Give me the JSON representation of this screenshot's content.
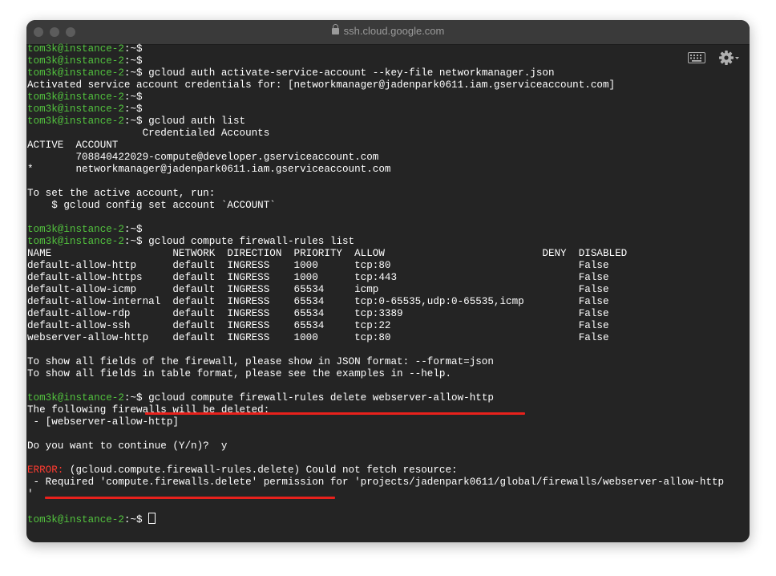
{
  "window": {
    "title": "ssh.cloud.google.com",
    "icons": [
      "keyboard-icon",
      "gear-icon",
      "lock-icon"
    ]
  },
  "colors": {
    "prompt": "#52c23e",
    "error": "#ff3b30",
    "underline": "#e8211c",
    "background": "#242424",
    "text": "#ffffff"
  },
  "terminal": {
    "prompt": "tom3k@instance-2",
    "prompt_suffix": ":~$ ",
    "lines": [
      {
        "prompt": true,
        "text": ""
      },
      {
        "prompt": true,
        "text": ""
      },
      {
        "prompt": true,
        "text": "gcloud auth activate-service-account --key-file networkmanager.json"
      },
      {
        "prompt": false,
        "text": "Activated service account credentials for: [networkmanager@jadenpark0611.iam.gserviceaccount.com]"
      },
      {
        "prompt": true,
        "text": ""
      },
      {
        "prompt": true,
        "text": ""
      },
      {
        "prompt": true,
        "text": "gcloud auth list"
      },
      {
        "prompt": false,
        "text": "                   Credentialed Accounts"
      },
      {
        "prompt": false,
        "text": "ACTIVE  ACCOUNT"
      },
      {
        "prompt": false,
        "text": "        708840422029-compute@developer.gserviceaccount.com"
      },
      {
        "prompt": false,
        "text": "*       networkmanager@jadenpark0611.iam.gserviceaccount.com"
      },
      {
        "prompt": false,
        "text": ""
      },
      {
        "prompt": false,
        "text": "To set the active account, run:"
      },
      {
        "prompt": false,
        "text": "    $ gcloud config set account `ACCOUNT`"
      },
      {
        "prompt": false,
        "text": ""
      },
      {
        "prompt": true,
        "text": ""
      },
      {
        "prompt": true,
        "text": "gcloud compute firewall-rules list"
      },
      {
        "prompt": false,
        "text": "NAME                    NETWORK  DIRECTION  PRIORITY  ALLOW                          DENY  DISABLED"
      },
      {
        "prompt": false,
        "text": "default-allow-http      default  INGRESS    1000      tcp:80                               False"
      },
      {
        "prompt": false,
        "text": "default-allow-https     default  INGRESS    1000      tcp:443                              False"
      },
      {
        "prompt": false,
        "text": "default-allow-icmp      default  INGRESS    65534     icmp                                 False"
      },
      {
        "prompt": false,
        "text": "default-allow-internal  default  INGRESS    65534     tcp:0-65535,udp:0-65535,icmp         False"
      },
      {
        "prompt": false,
        "text": "default-allow-rdp       default  INGRESS    65534     tcp:3389                             False"
      },
      {
        "prompt": false,
        "text": "default-allow-ssh       default  INGRESS    65534     tcp:22                               False"
      },
      {
        "prompt": false,
        "text": "webserver-allow-http    default  INGRESS    1000      tcp:80                               False"
      },
      {
        "prompt": false,
        "text": ""
      },
      {
        "prompt": false,
        "text": "To show all fields of the firewall, please show in JSON format: --format=json"
      },
      {
        "prompt": false,
        "text": "To show all fields in table format, please see the examples in --help."
      },
      {
        "prompt": false,
        "text": ""
      },
      {
        "prompt": true,
        "text": "gcloud compute firewall-rules delete webserver-allow-http"
      },
      {
        "prompt": false,
        "text": "The following firewalls will be deleted:"
      },
      {
        "prompt": false,
        "text": " - [webserver-allow-http]"
      },
      {
        "prompt": false,
        "text": ""
      },
      {
        "prompt": false,
        "text": "Do you want to continue (Y/n)?  y"
      },
      {
        "prompt": false,
        "text": ""
      },
      {
        "prompt": false,
        "error_label": "ERROR:",
        "text": " (gcloud.compute.firewall-rules.delete) Could not fetch resource:"
      },
      {
        "prompt": false,
        "text": " - Required 'compute.firewalls.delete' permission for 'projects/jadenpark0611/global/firewalls/webserver-allow-http"
      },
      {
        "prompt": false,
        "text": "'"
      },
      {
        "prompt": false,
        "text": ""
      },
      {
        "prompt": true,
        "text": "",
        "cursor": true
      }
    ]
  }
}
